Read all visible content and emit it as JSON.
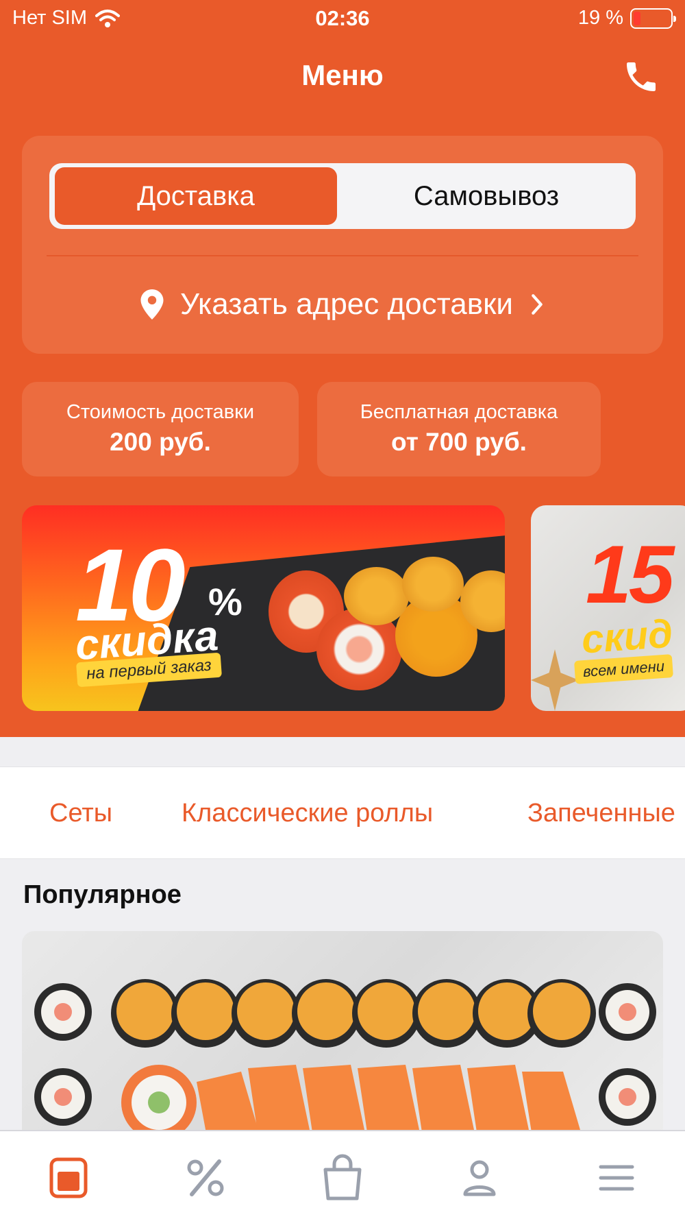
{
  "status_bar": {
    "carrier": "Нет SIM",
    "time": "02:36",
    "battery_text": "19 %",
    "battery_level": 0.19,
    "wifi_icon": "wifi-icon"
  },
  "header": {
    "title": "Меню",
    "phone_icon": "phone-icon"
  },
  "delivery_mode": {
    "options": [
      "Доставка",
      "Самовывоз"
    ],
    "selected": "Доставка"
  },
  "address": {
    "label": "Указать адрес доставки",
    "icon": "location-pin-icon"
  },
  "info": {
    "cost_label": "Стоимость доставки",
    "cost_value": "200 руб.",
    "free_label": "Бесплатная доставка",
    "free_value": "от 700 руб."
  },
  "banners": [
    {
      "number": "10",
      "percent": "%",
      "title": "скидка",
      "subtitle": "на первый заказ"
    },
    {
      "number": "15",
      "title": "скид",
      "subtitle": "всем имени"
    }
  ],
  "categories": [
    "Сеты",
    "Классические роллы",
    "Запеченные"
  ],
  "section": {
    "title": "Популярное"
  },
  "bottom_nav": [
    "menu-icon",
    "percent-icon",
    "bag-icon",
    "profile-icon",
    "hamburger-icon"
  ],
  "colors": {
    "accent": "#e95a2a",
    "card": "#ec6c3f",
    "inactive_icon": "#9aa0ac"
  }
}
